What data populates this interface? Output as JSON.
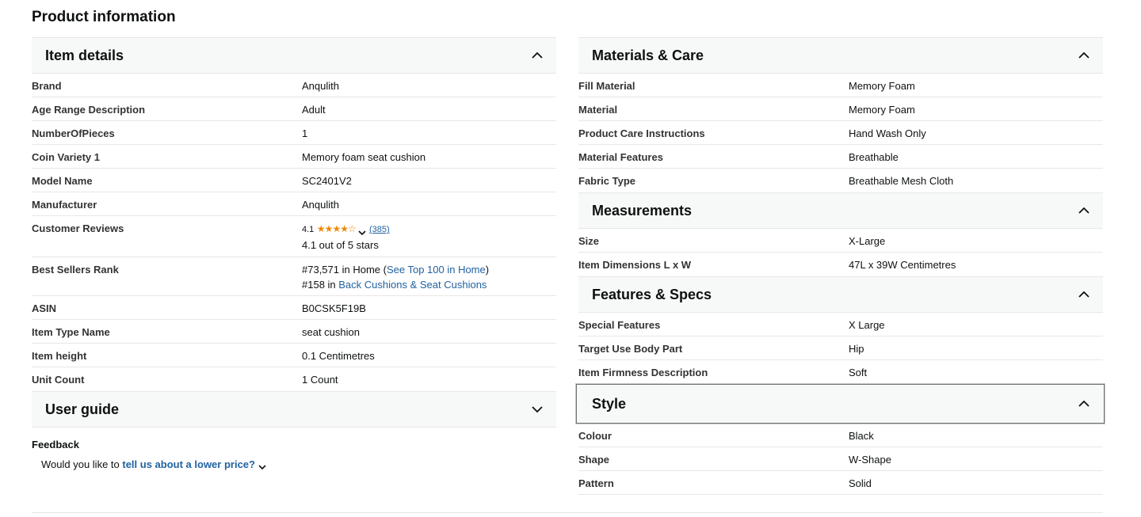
{
  "page_title": "Product information",
  "sections": {
    "item_details": {
      "title": "Item details",
      "rows": [
        {
          "key": "Brand",
          "value": "Anqulith"
        },
        {
          "key": "Age Range Description",
          "value": "Adult"
        },
        {
          "key": "NumberOfPieces",
          "value": "1"
        },
        {
          "key": "Coin Variety 1",
          "value": "Memory foam seat cushion"
        },
        {
          "key": "Model Name",
          "value": "SC2401V2"
        },
        {
          "key": "Manufacturer",
          "value": "Anqulith"
        }
      ],
      "reviews": {
        "key": "Customer Reviews",
        "rating": "4.1",
        "stars": "★★★★☆",
        "count": "(385)",
        "summary": "4.1 out of 5 stars"
      },
      "rank": {
        "key": "Best Sellers Rank",
        "line1_prefix": "#73,571 in Home (",
        "line1_link": "See Top 100 in Home",
        "line1_suffix": ")",
        "line2_prefix": "#158 in ",
        "line2_link": "Back Cushions & Seat Cushions"
      },
      "rows2": [
        {
          "key": "ASIN",
          "value": "B0CSK5F19B"
        },
        {
          "key": "Item Type Name",
          "value": "seat cushion"
        },
        {
          "key": "Item height",
          "value": "0.1 Centimetres"
        },
        {
          "key": "Unit Count",
          "value": "1 Count"
        }
      ]
    },
    "user_guide": {
      "title": "User guide"
    },
    "feedback": {
      "title": "Feedback",
      "prefix": "Would you like to ",
      "link": "tell us about a lower price?"
    },
    "materials_care": {
      "title": "Materials & Care",
      "rows": [
        {
          "key": "Fill Material",
          "value": "Memory Foam"
        },
        {
          "key": "Material",
          "value": "Memory Foam"
        },
        {
          "key": "Product Care Instructions",
          "value": "Hand Wash Only"
        },
        {
          "key": "Material Features",
          "value": "Breathable"
        },
        {
          "key": "Fabric Type",
          "value": "Breathable Mesh Cloth"
        }
      ]
    },
    "measurements": {
      "title": "Measurements",
      "rows": [
        {
          "key": "Size",
          "value": "X-Large"
        },
        {
          "key": "Item Dimensions L x W",
          "value": "47L x 39W Centimetres"
        }
      ]
    },
    "features_specs": {
      "title": "Features & Specs",
      "rows": [
        {
          "key": "Special Features",
          "value": "X Large"
        },
        {
          "key": "Target Use Body Part",
          "value": "Hip"
        },
        {
          "key": "Item Firmness Description",
          "value": "Soft"
        }
      ]
    },
    "style": {
      "title": "Style",
      "rows": [
        {
          "key": "Colour",
          "value": "Black"
        },
        {
          "key": "Shape",
          "value": "W-Shape"
        },
        {
          "key": "Pattern",
          "value": "Solid"
        }
      ]
    }
  },
  "icons": {
    "collapse": "chevron-up-icon",
    "expand": "chevron-down-icon"
  }
}
